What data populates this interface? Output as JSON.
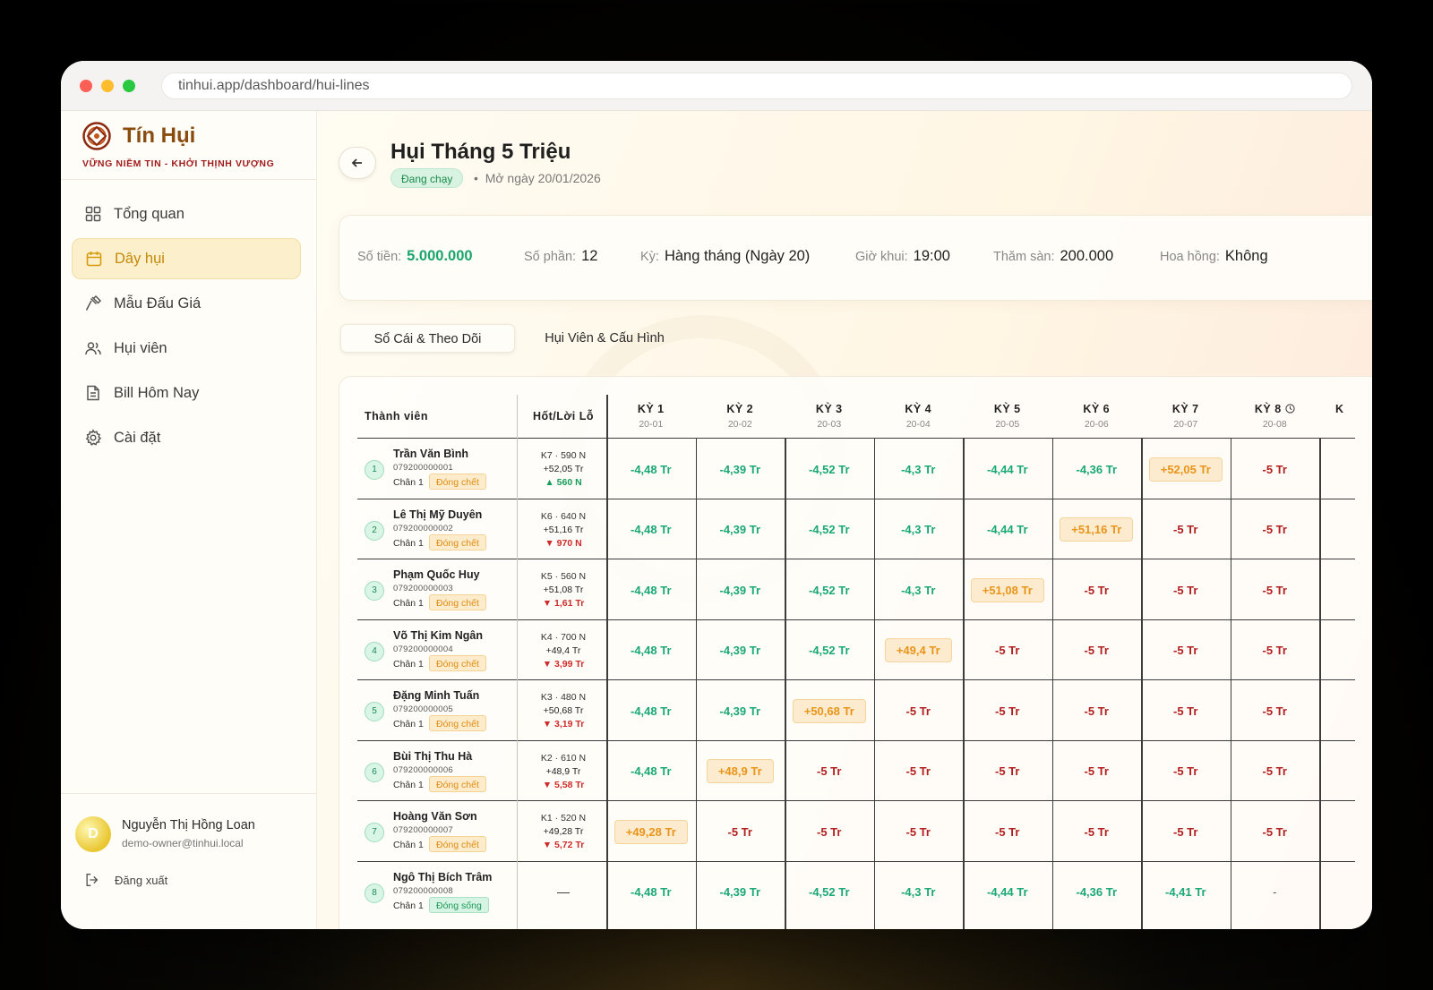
{
  "browser": {
    "url": "tinhui.app/dashboard/hui-lines"
  },
  "brand": {
    "name": "Tín Hụi",
    "tagline": "VỮNG NIỀM TIN - KHỞI THỊNH VƯỢNG"
  },
  "nav": [
    {
      "label": "Tổng quan",
      "icon": "grid-icon",
      "active": false
    },
    {
      "label": "Dây hụi",
      "icon": "calendar-icon",
      "active": true
    },
    {
      "label": "Mẫu Đấu Giá",
      "icon": "gavel-icon",
      "active": false
    },
    {
      "label": "Hụi viên",
      "icon": "users-icon",
      "active": false
    },
    {
      "label": "Bill Hôm Nay",
      "icon": "document-icon",
      "active": false
    },
    {
      "label": "Cài đặt",
      "icon": "gear-icon",
      "active": false
    }
  ],
  "user": {
    "initial": "D",
    "name": "Nguyễn Thị Hồng Loan",
    "email": "demo-owner@tinhui.local",
    "logout_label": "Đăng xuất"
  },
  "header": {
    "title": "Hụi Tháng 5 Triệu",
    "status": "Đang chạy",
    "separator": "•",
    "opened": "Mở ngày 20/01/2026"
  },
  "info": {
    "amount_label": "Số tiền:",
    "amount": "5.000.000",
    "shares_label": "Số phần:",
    "shares": "12",
    "period_label": "Kỳ:",
    "period": "Hàng tháng (Ngày 20)",
    "time_label": "Giờ khui:",
    "time": "19:00",
    "floor_label": "Thăm sàn:",
    "floor": "200.000",
    "commission_label": "Hoa hồng:",
    "commission": "Không"
  },
  "tabs": [
    {
      "label": "Sổ Cái & Theo Dõi",
      "active": true
    },
    {
      "label": "Hụi Viên & Cấu Hình",
      "active": false
    }
  ],
  "table": {
    "member_header": "Thành viên",
    "pl_header": "Hốt/Lời Lỗ",
    "periods": [
      {
        "label": "KỲ 1",
        "date": "20-01"
      },
      {
        "label": "KỲ 2",
        "date": "20-02"
      },
      {
        "label": "KỲ 3",
        "date": "20-03"
      },
      {
        "label": "KỲ 4",
        "date": "20-04"
      },
      {
        "label": "KỲ 5",
        "date": "20-05"
      },
      {
        "label": "KỲ 6",
        "date": "20-06"
      },
      {
        "label": "KỲ 7",
        "date": "20-07"
      },
      {
        "label": "KỲ 8",
        "date": "20-08",
        "clock": true
      },
      {
        "label": "K",
        "date": ""
      }
    ],
    "members": [
      {
        "no": "1",
        "name": "Trần Văn Bình",
        "id": "079200000001",
        "chan": "Chân 1",
        "tag": "Đóng chết",
        "tag_type": "dead",
        "pl": [
          "K7 · 590 N",
          "+52,05 Tr",
          "▲ 560 N"
        ],
        "pl_dir": "up",
        "cells": [
          "-4,48 Tr",
          "-4,39 Tr",
          "-4,52 Tr",
          "-4,3 Tr",
          "-4,44 Tr",
          "-4,36 Tr",
          "+52,05 Tr",
          "-5 Tr"
        ]
      },
      {
        "no": "2",
        "name": "Lê Thị Mỹ Duyên",
        "id": "079200000002",
        "chan": "Chân 1",
        "tag": "Đóng chết",
        "tag_type": "dead",
        "pl": [
          "K6 · 640 N",
          "+51,16 Tr",
          "▼ 970 N"
        ],
        "pl_dir": "down",
        "cells": [
          "-4,48 Tr",
          "-4,39 Tr",
          "-4,52 Tr",
          "-4,3 Tr",
          "-4,44 Tr",
          "+51,16 Tr",
          "-5 Tr",
          "-5 Tr"
        ]
      },
      {
        "no": "3",
        "name": "Phạm Quốc Huy",
        "id": "079200000003",
        "chan": "Chân 1",
        "tag": "Đóng chết",
        "tag_type": "dead",
        "pl": [
          "K5 · 560 N",
          "+51,08 Tr",
          "▼ 1,61 Tr"
        ],
        "pl_dir": "down",
        "cells": [
          "-4,48 Tr",
          "-4,39 Tr",
          "-4,52 Tr",
          "-4,3 Tr",
          "+51,08 Tr",
          "-5 Tr",
          "-5 Tr",
          "-5 Tr"
        ]
      },
      {
        "no": "4",
        "name": "Võ Thị Kim Ngân",
        "id": "079200000004",
        "chan": "Chân 1",
        "tag": "Đóng chết",
        "tag_type": "dead",
        "pl": [
          "K4 · 700 N",
          "+49,4 Tr",
          "▼ 3,99 Tr"
        ],
        "pl_dir": "down",
        "cells": [
          "-4,48 Tr",
          "-4,39 Tr",
          "-4,52 Tr",
          "+49,4 Tr",
          "-5 Tr",
          "-5 Tr",
          "-5 Tr",
          "-5 Tr"
        ]
      },
      {
        "no": "5",
        "name": "Đặng Minh Tuấn",
        "id": "079200000005",
        "chan": "Chân 1",
        "tag": "Đóng chết",
        "tag_type": "dead",
        "pl": [
          "K3 · 480 N",
          "+50,68 Tr",
          "▼ 3,19 Tr"
        ],
        "pl_dir": "down",
        "cells": [
          "-4,48 Tr",
          "-4,39 Tr",
          "+50,68 Tr",
          "-5 Tr",
          "-5 Tr",
          "-5 Tr",
          "-5 Tr",
          "-5 Tr"
        ]
      },
      {
        "no": "6",
        "name": "Bùi Thị Thu Hà",
        "id": "079200000006",
        "chan": "Chân 1",
        "tag": "Đóng chết",
        "tag_type": "dead",
        "pl": [
          "K2 · 610 N",
          "+48,9 Tr",
          "▼ 5,58 Tr"
        ],
        "pl_dir": "down",
        "cells": [
          "-4,48 Tr",
          "+48,9 Tr",
          "-5 Tr",
          "-5 Tr",
          "-5 Tr",
          "-5 Tr",
          "-5 Tr",
          "-5 Tr"
        ]
      },
      {
        "no": "7",
        "name": "Hoàng Văn Sơn",
        "id": "079200000007",
        "chan": "Chân 1",
        "tag": "Đóng chết",
        "tag_type": "dead",
        "pl": [
          "K1 · 520 N",
          "+49,28 Tr",
          "▼ 5,72 Tr"
        ],
        "pl_dir": "down",
        "cells": [
          "+49,28 Tr",
          "-5 Tr",
          "-5 Tr",
          "-5 Tr",
          "-5 Tr",
          "-5 Tr",
          "-5 Tr",
          "-5 Tr"
        ]
      },
      {
        "no": "8",
        "name": "Ngô Thị Bích Trâm",
        "id": "079200000008",
        "chan": "Chân 1",
        "tag": "Đóng sống",
        "tag_type": "alive",
        "pl": [
          "—"
        ],
        "pl_dir": "none",
        "cells": [
          "-4,48 Tr",
          "-4,39 Tr",
          "-4,52 Tr",
          "-4,3 Tr",
          "-4,44 Tr",
          "-4,36 Tr",
          "-4,41 Tr",
          "-"
        ]
      }
    ]
  },
  "colors": {
    "accent": "#c48a08",
    "brand": "#8a4b0f",
    "positive": "#1aa878",
    "negative": "#b21f1f",
    "highlight": "#e8951a"
  }
}
